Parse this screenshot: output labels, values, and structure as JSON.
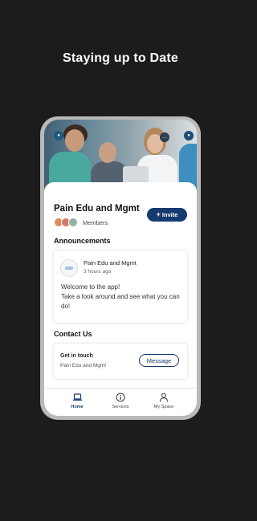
{
  "headline": "Staying up to Date",
  "app": {
    "name": "Pain Edu and Mgmt",
    "members_label": "Members",
    "invite_label": "Invite",
    "invite_icon": "plus-icon"
  },
  "announcements": {
    "title": "Announcements",
    "post": {
      "author": "Pain Edu and Mgmt",
      "time": "3 hours ago",
      "line1": "Welcome to the app!",
      "line2": "Take a look around and see what you can do!"
    }
  },
  "contact": {
    "title": "Contact Us",
    "heading": "Get in touch",
    "subtitle": "Pain Edu and Mgmt",
    "button_label": "Message"
  },
  "tabs": [
    {
      "label": "Home",
      "icon": "laptop-icon",
      "active": true
    },
    {
      "label": "Services",
      "icon": "info-icon",
      "active": false
    },
    {
      "label": "My Space",
      "icon": "person-icon",
      "active": false
    }
  ],
  "colors": {
    "background": "#1c1c1c",
    "accent": "#163a70",
    "device_frame": "#b9b9b9"
  }
}
